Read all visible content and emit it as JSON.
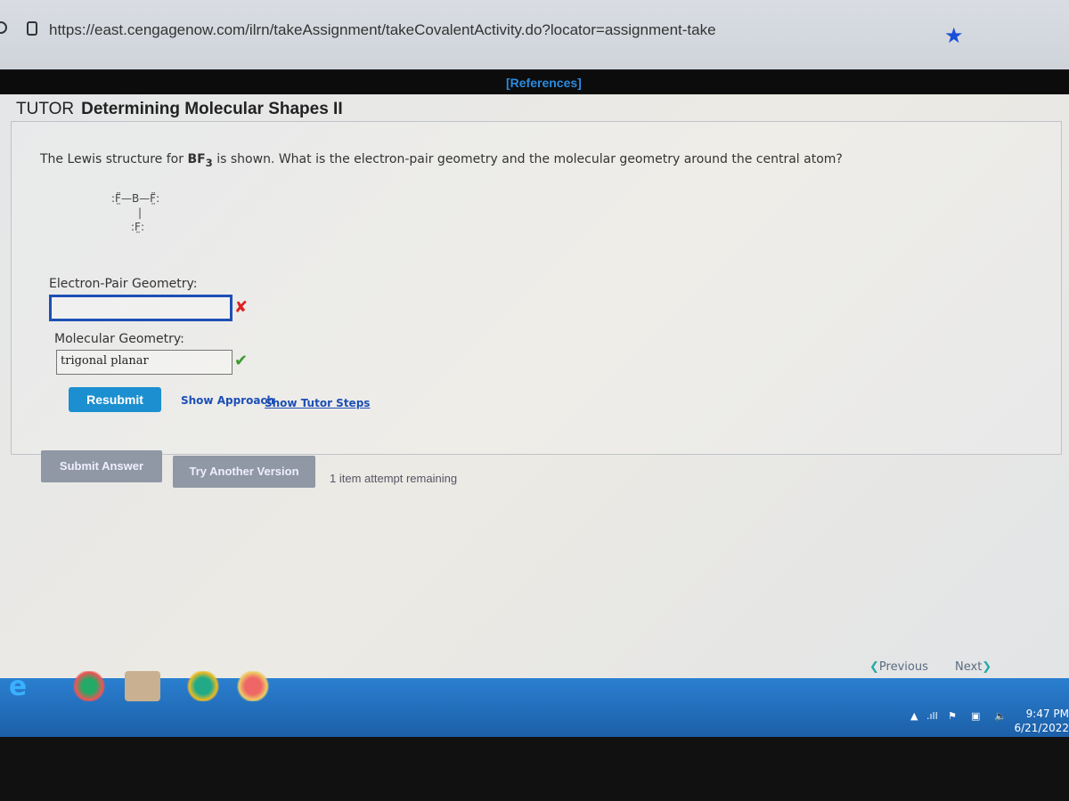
{
  "browser": {
    "url": "https://east.cengagenow.com/ilrn/takeAssignment/takeCovalentActivity.do?locator=assignment-take",
    "star_color": "#1a4fd6"
  },
  "header": {
    "references": "[References]",
    "tutor": "TUTOR",
    "title": "Determining Molecular Shapes II"
  },
  "question": {
    "prefix": "The Lewis structure for ",
    "formula": "BF",
    "subscript": "3",
    "suffix": " is shown. What is the electron-pair geometry and the molecular geometry around the central atom?"
  },
  "lewis": {
    "line1": ":F̤̈—B—F̤̈:",
    "line2": "|",
    "line3": ":F̤:"
  },
  "fields": {
    "electron_pair_label": "Electron-Pair Geometry:",
    "electron_pair_value": "",
    "electron_pair_status": "incorrect",
    "molecular_label": "Molecular Geometry:",
    "molecular_value": "trigonal planar",
    "molecular_status": "correct"
  },
  "icons": {
    "incorrect": "✘",
    "correct": "✔"
  },
  "actions": {
    "resubmit": "Resubmit",
    "show_approach": "Show Approach",
    "show_tutor_steps": "Show Tutor Steps",
    "submit_answer": "Submit Answer",
    "try_another": "Try Another Version",
    "attempts": "1 item attempt remaining"
  },
  "nav": {
    "previous": "Previous",
    "next": "Next"
  },
  "taskbar": {
    "time": "9:47 PM",
    "date": "6/21/2022"
  }
}
